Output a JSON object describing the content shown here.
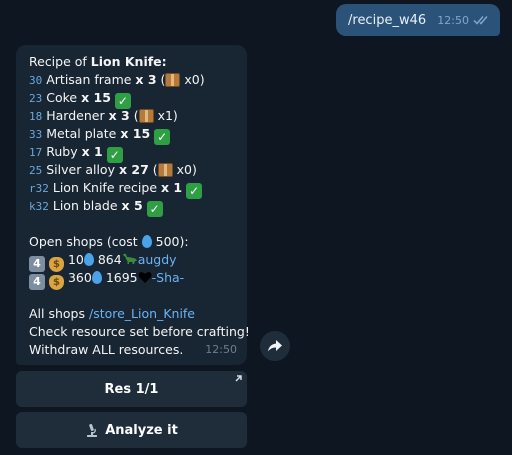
{
  "outgoing": {
    "text": "/recipe_w46",
    "time": "12:50"
  },
  "message": {
    "title_prefix": "Recipe of ",
    "title_item": "Lion Knife:",
    "ingredients": [
      {
        "code": "30",
        "name": "Artisan frame",
        "qty": "x 3",
        "stock_open": "(",
        "stock": "x0)"
      },
      {
        "code": "23",
        "name": "Coke",
        "qty": "x 15"
      },
      {
        "code": "18",
        "name": "Hardener",
        "qty": "x 3",
        "stock_open": "(",
        "stock": "x1)"
      },
      {
        "code": "33",
        "name": "Metal plate",
        "qty": "x 15"
      },
      {
        "code": "17",
        "name": "Ruby",
        "qty": "x 1"
      },
      {
        "code": "25",
        "name": "Silver alloy",
        "qty": "x 27",
        "stock_open": "(",
        "stock": "x0)"
      },
      {
        "code": "r32",
        "name": "Lion Knife recipe",
        "qty": "x 1"
      },
      {
        "code": "k32",
        "name": "Lion blade",
        "qty": "x 5"
      }
    ],
    "open_shops_label": "Open shops (cost",
    "open_shops_cost": "500):",
    "shops": [
      {
        "rank": "4",
        "gold": "10",
        "mana": "864",
        "owner": "augdy"
      },
      {
        "rank": "4",
        "gold": "360",
        "mana": "1695",
        "owner": "-Sha-"
      }
    ],
    "all_shops_label": "All shops",
    "all_shops_link": "/store_Lion_Knife",
    "note_1": "Check resource set before crafting!",
    "note_2": "Withdraw ALL resources.",
    "time": "12:50"
  },
  "buttons": {
    "res": "Res 1/1",
    "analyze": "Analyze it"
  },
  "icons": {
    "check": "check-mark-icon",
    "box": "package-icon",
    "drop": "droplet-icon",
    "keycap": "keycap-4-icon",
    "moneybag": "money-bag-icon",
    "dino": "sauropod-icon",
    "heart": "black-heart-icon",
    "share": "share-arrow-icon",
    "microscope": "microscope-icon"
  },
  "colors": {
    "background": "#0e1621",
    "bubble_in": "#182533",
    "bubble_out": "#2b5278",
    "link": "#6ab3f3",
    "item_code": "#6aa8dc"
  }
}
